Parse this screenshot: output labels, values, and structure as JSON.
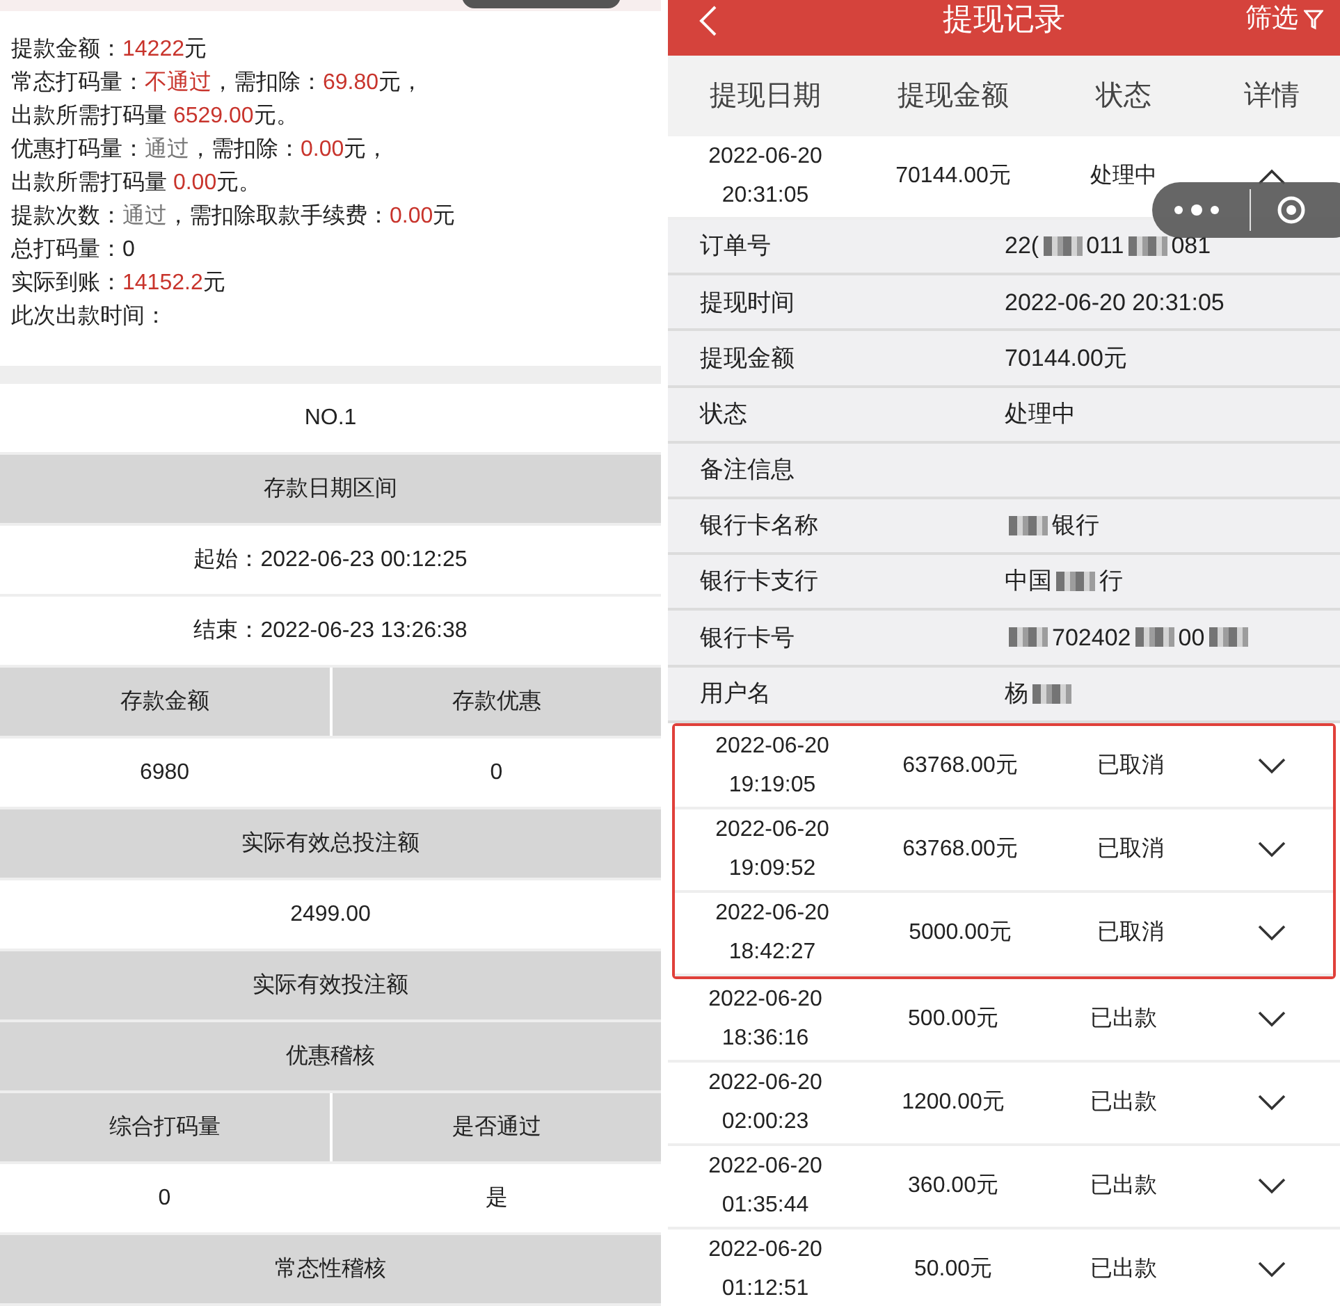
{
  "left_panel": {
    "summary_lines": [
      [
        {
          "kind": "label",
          "text": "提款金额："
        },
        {
          "kind": "value",
          "text": "14222"
        },
        {
          "kind": "label",
          "text": "元"
        }
      ],
      [
        {
          "kind": "label",
          "text": "常态打码量："
        },
        {
          "kind": "fail",
          "text": "不通过"
        },
        {
          "kind": "label",
          "text": "，需扣除："
        },
        {
          "kind": "value",
          "text": "69.80"
        },
        {
          "kind": "label",
          "text": "元，"
        }
      ],
      [
        {
          "kind": "label",
          "text": "出款所需打码量 "
        },
        {
          "kind": "value",
          "text": "6529.00"
        },
        {
          "kind": "label",
          "text": "元。"
        }
      ],
      [
        {
          "kind": "label",
          "text": "优惠打码量："
        },
        {
          "kind": "pass",
          "text": "通过"
        },
        {
          "kind": "label",
          "text": "，需扣除："
        },
        {
          "kind": "value",
          "text": "0.00"
        },
        {
          "kind": "label",
          "text": "元，"
        }
      ],
      [
        {
          "kind": "label",
          "text": "出款所需打码量 "
        },
        {
          "kind": "value",
          "text": "0.00"
        },
        {
          "kind": "label",
          "text": "元。"
        }
      ],
      [
        {
          "kind": "label",
          "text": "提款次数："
        },
        {
          "kind": "pass",
          "text": "通过"
        },
        {
          "kind": "label",
          "text": "，需扣除取款手续费："
        },
        {
          "kind": "value",
          "text": "0.00"
        },
        {
          "kind": "label",
          "text": "元"
        }
      ],
      [
        {
          "kind": "label",
          "text": "总打码量：0"
        }
      ],
      [
        {
          "kind": "label",
          "text": "实际到账："
        },
        {
          "kind": "value",
          "text": "14152.2"
        },
        {
          "kind": "label",
          "text": "元"
        }
      ],
      [
        {
          "kind": "label",
          "text": "此次出款时间："
        }
      ]
    ],
    "table_rows": [
      {
        "kind": "value",
        "cells": [
          "NO.1"
        ]
      },
      {
        "kind": "heading",
        "cells": [
          "存款日期区间"
        ]
      },
      {
        "kind": "value",
        "cells": [
          "起始：2022-06-23 00:12:25"
        ]
      },
      {
        "kind": "value",
        "cells": [
          "结束：2022-06-23 13:26:38"
        ]
      },
      {
        "kind": "heading",
        "cells": [
          "存款金额",
          "存款优惠"
        ]
      },
      {
        "kind": "value",
        "cells": [
          "6980",
          "0"
        ]
      },
      {
        "kind": "heading",
        "cells": [
          "实际有效总投注额"
        ]
      },
      {
        "kind": "value",
        "cells": [
          "2499.00"
        ]
      },
      {
        "kind": "heading",
        "cells": [
          "实际有效投注额"
        ]
      },
      {
        "kind": "heading",
        "cells": [
          "优惠稽核"
        ]
      },
      {
        "kind": "heading",
        "cells": [
          "综合打码量",
          "是否通过"
        ]
      },
      {
        "kind": "value",
        "cells": [
          "0",
          "是"
        ]
      },
      {
        "kind": "heading",
        "cells": [
          "常态性稽核"
        ]
      }
    ]
  },
  "right_panel": {
    "title": "提现记录",
    "filter": "筛选",
    "columns": [
      "提现日期",
      "提现金额",
      "状态",
      "详情"
    ],
    "records": [
      {
        "date": "2022-06-20",
        "time": "20:31:05",
        "amount": "70144.00元",
        "status": "处理中",
        "expanded": true,
        "highlighted": false,
        "details": [
          {
            "label": "订单号",
            "value": [
              {
                "kind": "text",
                "text": "22("
              },
              {
                "kind": "mask"
              },
              {
                "kind": "text",
                "text": "011"
              },
              {
                "kind": "mask"
              },
              {
                "kind": "text",
                "text": "081"
              }
            ]
          },
          {
            "label": "提现时间",
            "value": [
              {
                "kind": "text",
                "text": "2022-06-20 20:31:05"
              }
            ]
          },
          {
            "label": "提现金额",
            "value": [
              {
                "kind": "text",
                "text": "70144.00元"
              }
            ]
          },
          {
            "label": "状态",
            "value": [
              {
                "kind": "text",
                "text": "处理中"
              }
            ]
          },
          {
            "label": "备注信息"
          },
          {
            "label": "银行卡名称",
            "value": [
              {
                "kind": "mask"
              },
              {
                "kind": "text",
                "text": "银行"
              }
            ]
          },
          {
            "label": "银行卡支行",
            "value": [
              {
                "kind": "text",
                "text": "中国"
              },
              {
                "kind": "mask"
              },
              {
                "kind": "text",
                "text": "行"
              }
            ]
          },
          {
            "label": "银行卡号",
            "value": [
              {
                "kind": "mask"
              },
              {
                "kind": "text",
                "text": "702402"
              },
              {
                "kind": "mask"
              },
              {
                "kind": "text",
                "text": "00"
              },
              {
                "kind": "mask"
              }
            ]
          },
          {
            "label": "用户名",
            "value": [
              {
                "kind": "text",
                "text": "杨"
              },
              {
                "kind": "mask"
              }
            ]
          }
        ]
      },
      {
        "date": "2022-06-20",
        "time": "19:19:05",
        "amount": "63768.00元",
        "status": "已取消",
        "expanded": false,
        "highlighted": true
      },
      {
        "date": "2022-06-20",
        "time": "19:09:52",
        "amount": "63768.00元",
        "status": "已取消",
        "expanded": false,
        "highlighted": true
      },
      {
        "date": "2022-06-20",
        "time": "18:42:27",
        "amount": "5000.00元",
        "status": "已取消",
        "expanded": false,
        "highlighted": true
      },
      {
        "date": "2022-06-20",
        "time": "18:36:16",
        "amount": "500.00元",
        "status": "已出款",
        "expanded": false,
        "highlighted": false
      },
      {
        "date": "2022-06-20",
        "time": "02:00:23",
        "amount": "1200.00元",
        "status": "已出款",
        "expanded": false,
        "highlighted": false
      },
      {
        "date": "2022-06-20",
        "time": "01:35:44",
        "amount": "360.00元",
        "status": "已出款",
        "expanded": false,
        "highlighted": false
      },
      {
        "date": "2022-06-20",
        "time": "01:12:51",
        "amount": "50.00元",
        "status": "已出款",
        "expanded": false,
        "highlighted": false
      }
    ]
  }
}
